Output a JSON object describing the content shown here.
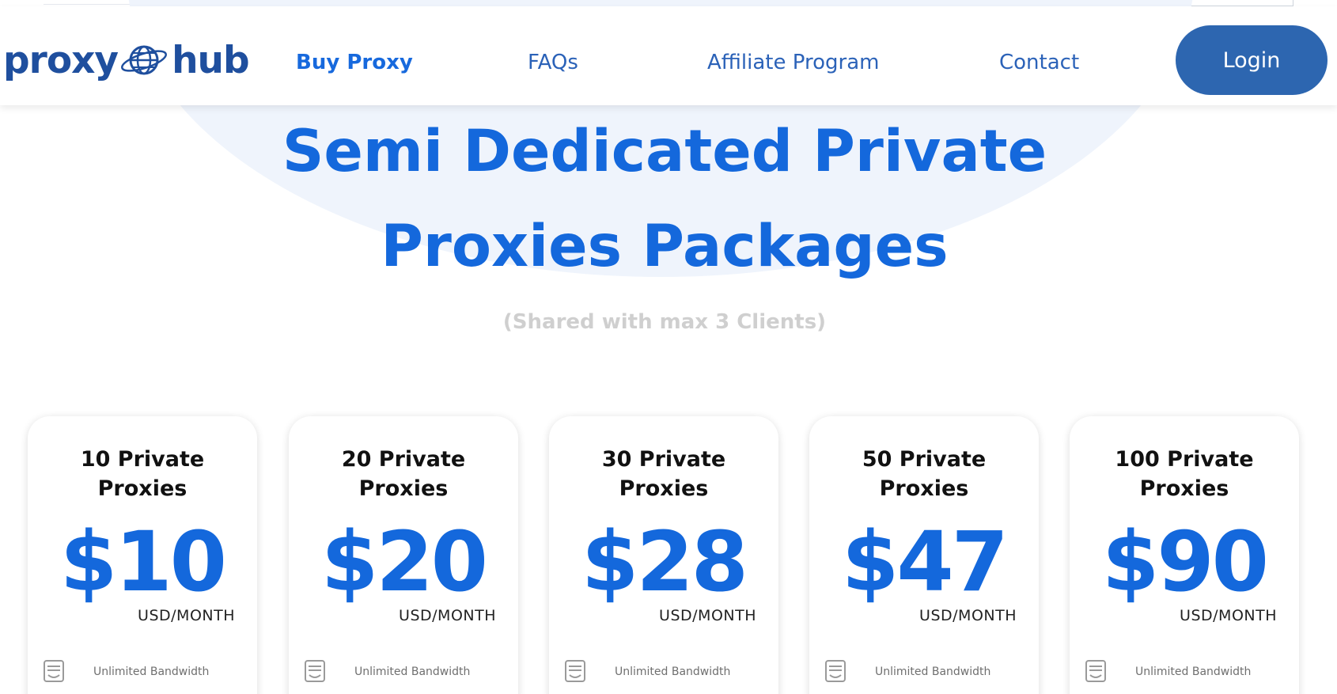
{
  "brand": {
    "name_left": "proxy",
    "name_right": "hub"
  },
  "nav": {
    "buy_proxy": "Buy Proxy",
    "faqs": "FAQs",
    "affiliate": "Affiliate Program",
    "contact": "Contact",
    "login": "Login"
  },
  "hero": {
    "title_line1": "Semi Dedicated Private",
    "title_line2": "Proxies Packages",
    "subtitle": "(Shared with max 3 Clients)"
  },
  "packages": [
    {
      "title_line1": "10 Private",
      "title_line2": "Proxies",
      "price": "$10",
      "unit": "USD/MONTH",
      "feature": "Unlimited Bandwidth"
    },
    {
      "title_line1": "20 Private",
      "title_line2": "Proxies",
      "price": "$20",
      "unit": "USD/MONTH",
      "feature": "Unlimited Bandwidth"
    },
    {
      "title_line1": "30 Private",
      "title_line2": "Proxies",
      "price": "$28",
      "unit": "USD/MONTH",
      "feature": "Unlimited Bandwidth"
    },
    {
      "title_line1": "50 Private",
      "title_line2": "Proxies",
      "price": "$47",
      "unit": "USD/MONTH",
      "feature": "Unlimited Bandwidth"
    },
    {
      "title_line1": "100 Private",
      "title_line2": "Proxies",
      "price": "$90",
      "unit": "USD/MONTH",
      "feature": "Unlimited Bandwidth"
    }
  ],
  "colors": {
    "primary": "#1468dc",
    "brand_dark": "#1f4f9e",
    "button": "#2d66b0",
    "nav_text": "#2b62b8",
    "muted": "#cfcfcf"
  },
  "icons": {
    "logo": "globe-icon",
    "feature": "bandwidth-icon"
  }
}
